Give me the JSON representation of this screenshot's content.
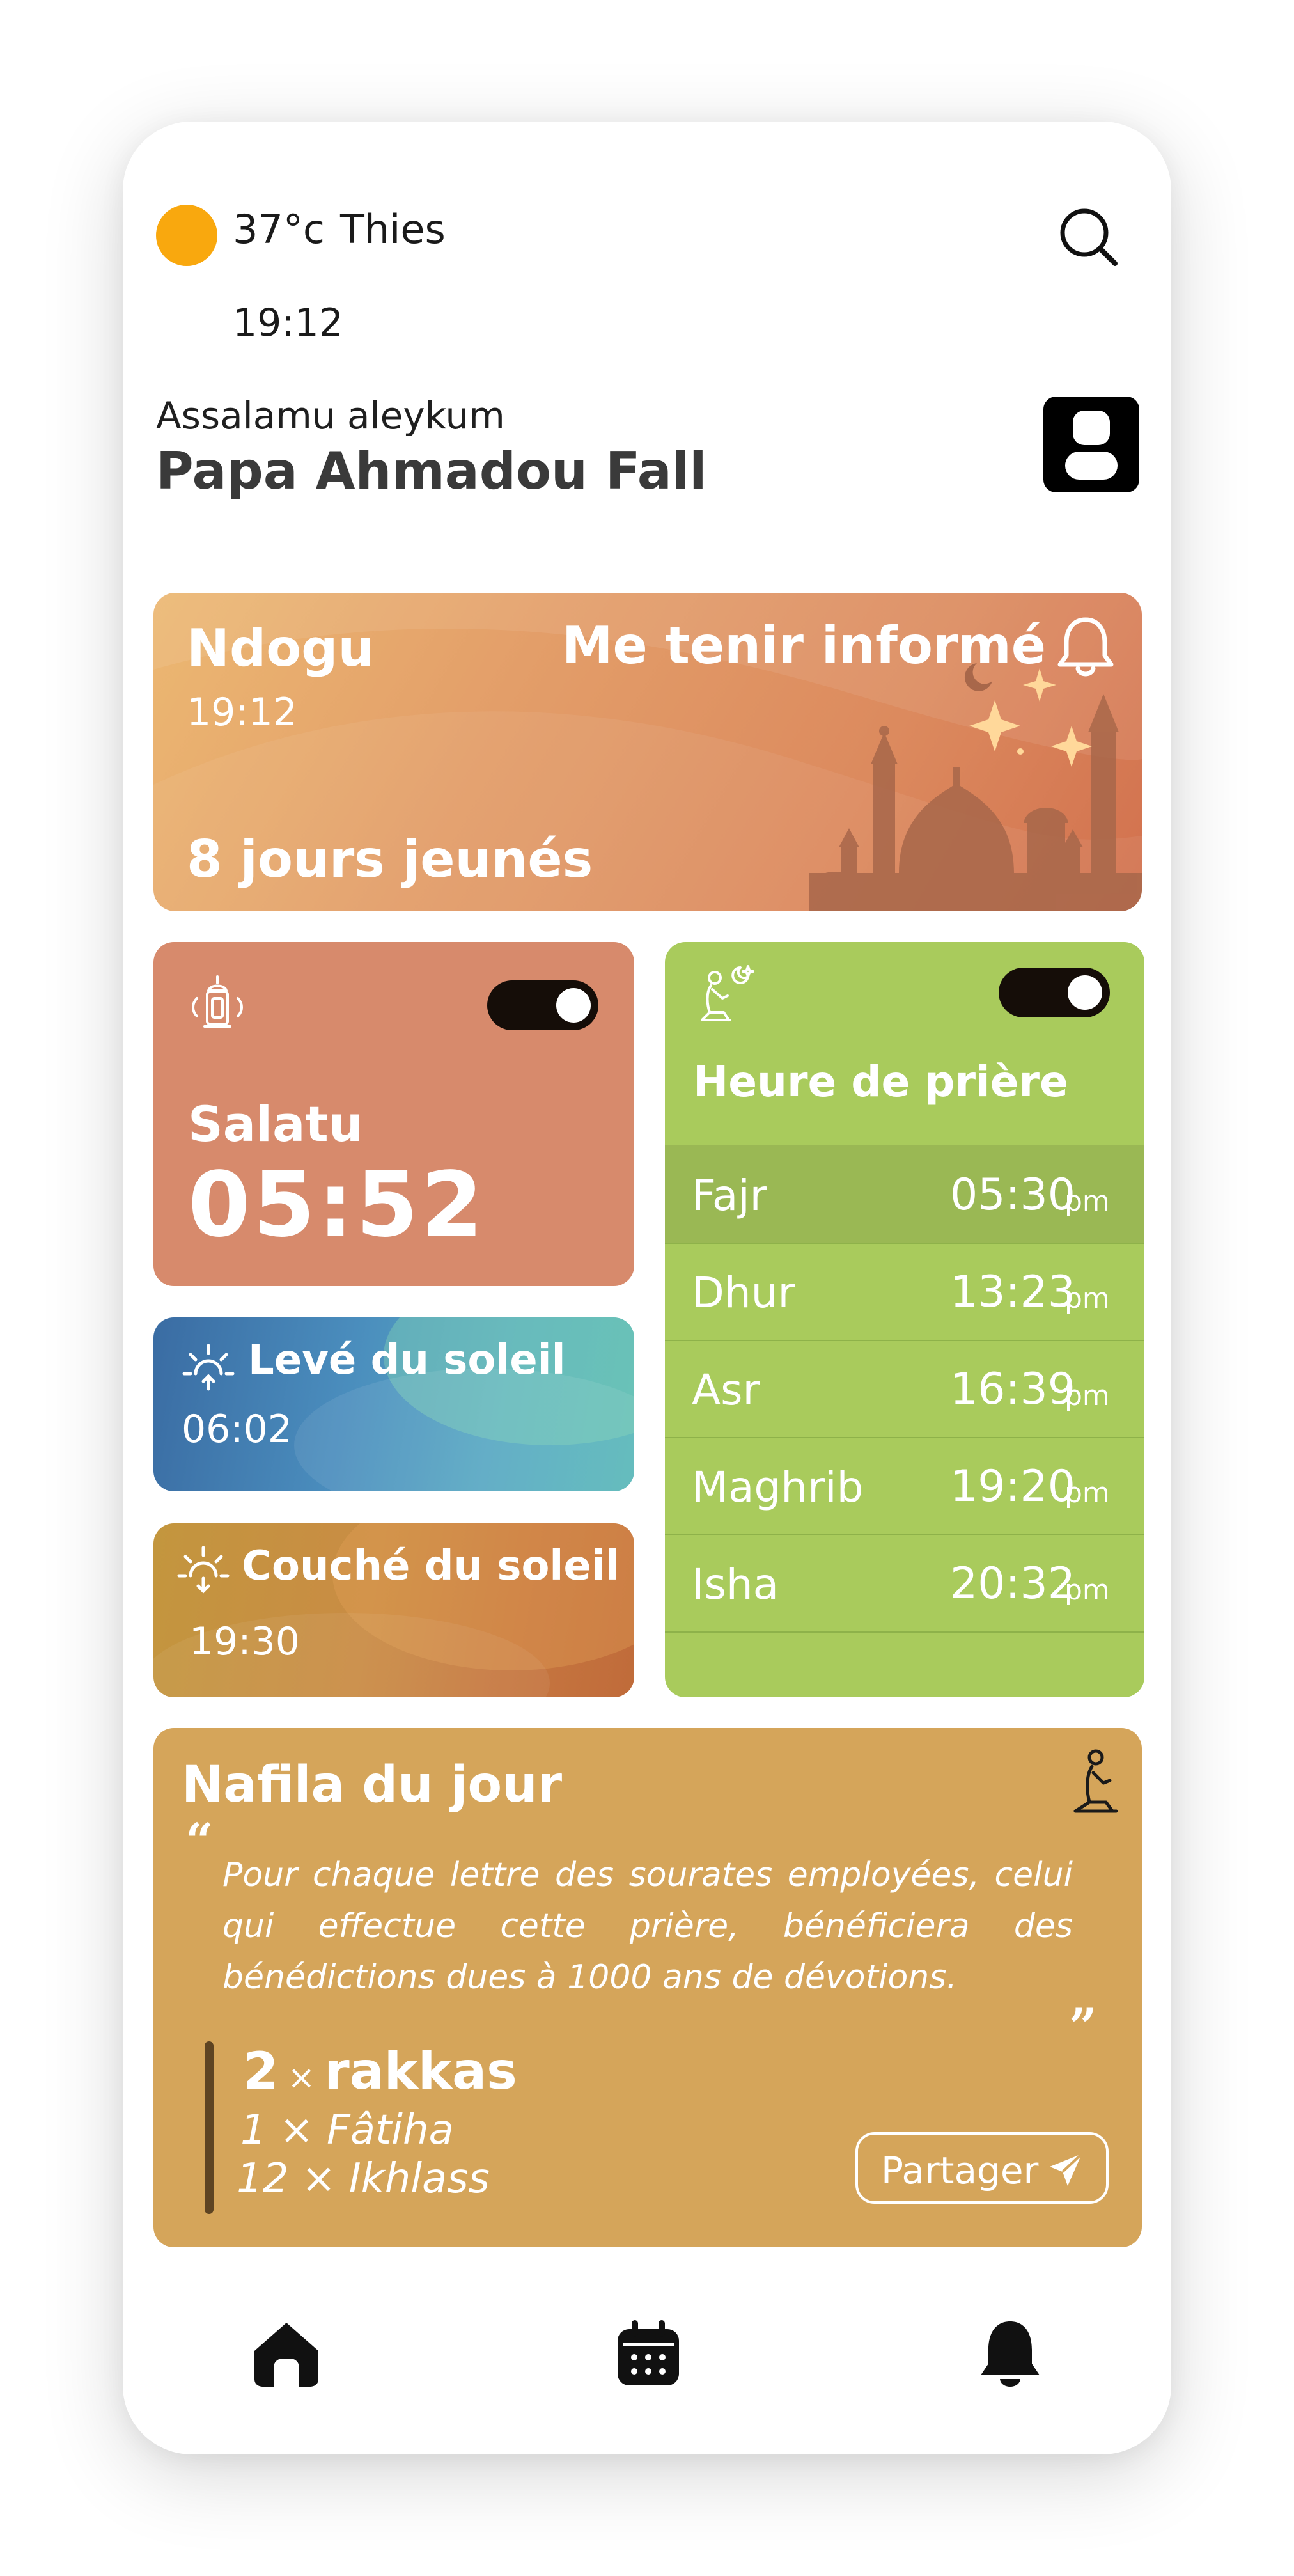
{
  "header": {
    "temperature": "37°c",
    "city": "Thies",
    "time": "19:12",
    "greeting": "Assalamu aleykum",
    "user_name": "Papa Ahmadou Fall"
  },
  "ndogu": {
    "title": "Ndogu",
    "time": "19:12",
    "days_fasted": "8 jours jeunés",
    "notify_label": "Me tenir informé"
  },
  "salatu": {
    "title": "Salatu",
    "time": "05:52",
    "toggle_on": true
  },
  "sunrise": {
    "label": "Levé du soleil",
    "time": "06:02"
  },
  "sunset": {
    "label": "Couché du soleil",
    "time": "19:30"
  },
  "prayer_times": {
    "title": "Heure de prière",
    "toggle_on": true,
    "rows": [
      {
        "name": "Fajr",
        "time": "05:30",
        "suffix": "pm",
        "active": true
      },
      {
        "name": "Dhur",
        "time": "13:23",
        "suffix": "pm"
      },
      {
        "name": "Asr",
        "time": "16:39",
        "suffix": "pm"
      },
      {
        "name": "Maghrib",
        "time": "19:20",
        "suffix": "pm"
      },
      {
        "name": "Isha",
        "time": "20:32",
        "suffix": "pm"
      }
    ]
  },
  "nafila": {
    "title": "Nafila du jour",
    "quote": "Pour chaque lettre des sourates employées, celui qui effectue cette prière, bénéficiera des bénédictions dues à 1000 ans de dévotions.",
    "rakkas_count": "2",
    "rakkas_label": "rakkas",
    "times_sign": "×",
    "line2": "1  × Fâtiha",
    "line3": "12 × Ikhlass",
    "share_label": "Partager"
  },
  "nav": {
    "items": [
      "home-icon",
      "calendar-icon",
      "bell-icon"
    ]
  },
  "colors": {
    "sun": "#f9a80e",
    "salatu_card": "#d78a6c",
    "prayer_card": "#a9cb5c",
    "nafila_card": "#d5a55a",
    "toggle": "#150d08"
  }
}
